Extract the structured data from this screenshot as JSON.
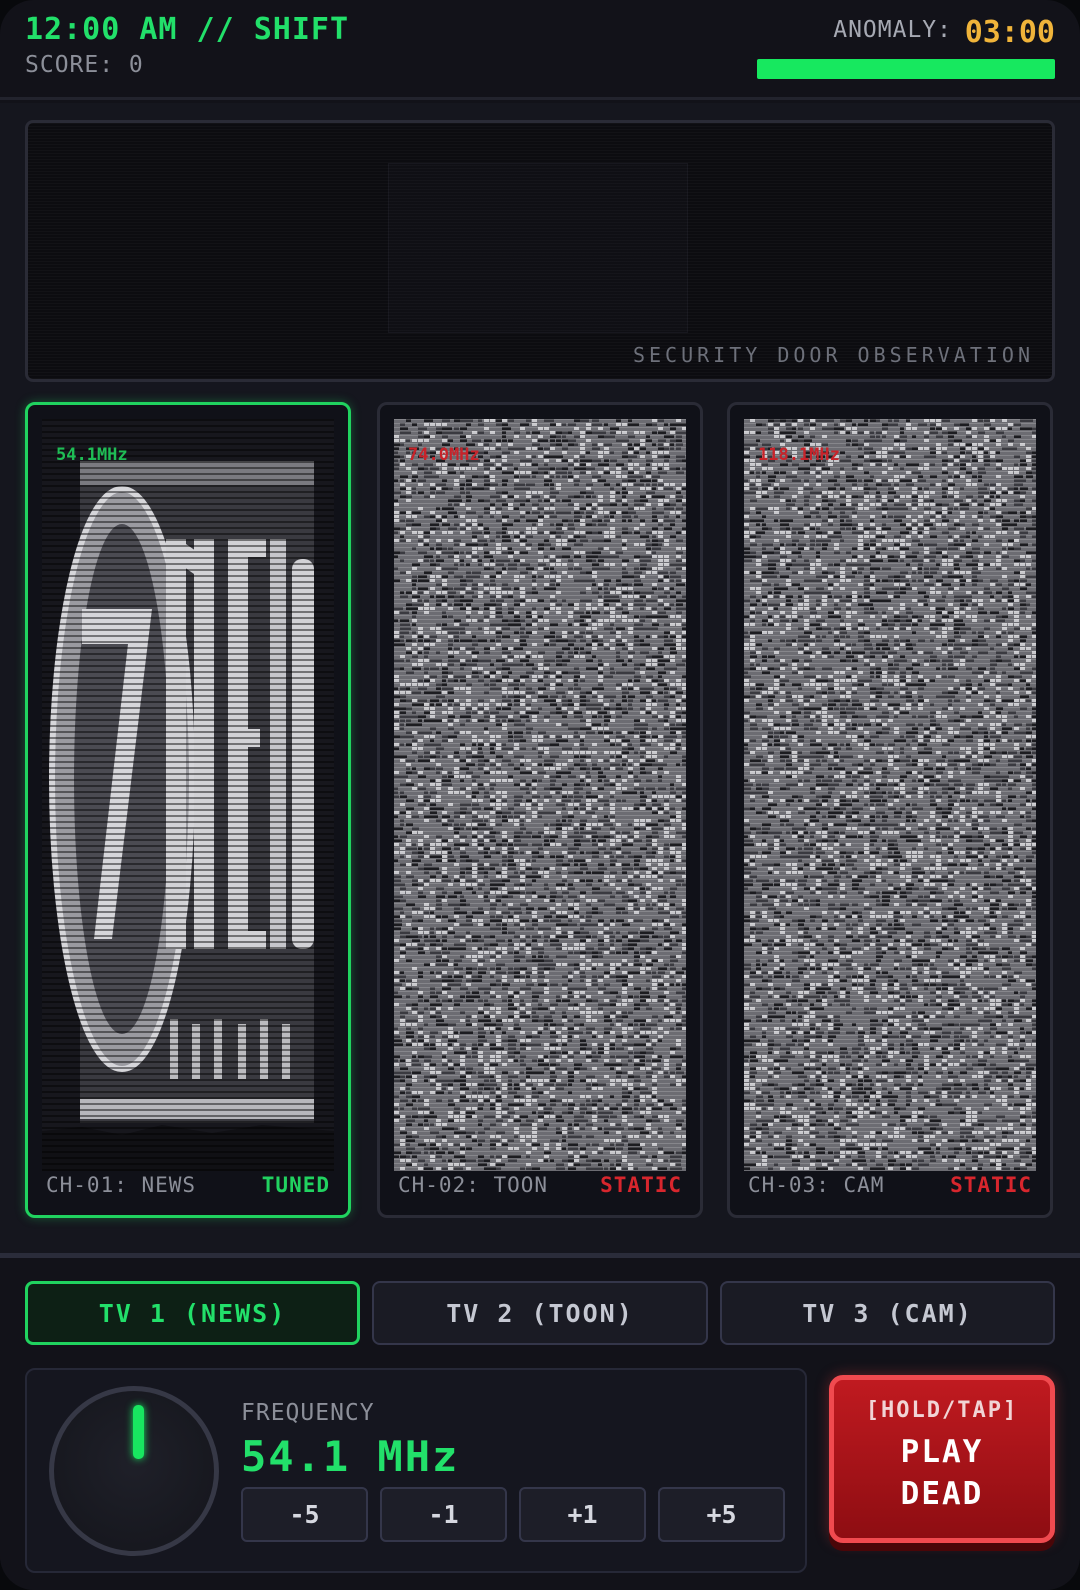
{
  "header": {
    "clock": "12:00 AM // SHIFT",
    "score": "SCORE: 0",
    "anomaly_label": "ANOMALY:",
    "anomaly_time": "03:00",
    "anomaly_fill_fraction": 1.0
  },
  "door_view": {
    "label": "SECURITY DOOR OBSERVATION"
  },
  "tvs": [
    {
      "freq": "54.1MHz",
      "channel": "CH-01: NEWS",
      "state": "TUNED",
      "display": "news-logo"
    },
    {
      "freq": "74.0MHz",
      "channel": "CH-02: TOON",
      "state": "STATIC",
      "display": "static"
    },
    {
      "freq": "118.1MHz",
      "channel": "CH-03: CAM",
      "state": "STATIC",
      "display": "static"
    }
  ],
  "tabs": [
    "TV 1 (NEWS)",
    "TV 2 (TOON)",
    "TV 3 (CAM)"
  ],
  "active_tab": 0,
  "tuner": {
    "title": "FREQUENCY",
    "value": "54.1 MHz",
    "steps": [
      "-5",
      "-1",
      "+1",
      "+5"
    ]
  },
  "play_dead": {
    "hint": "[HOLD/TAP]",
    "line1": "PLAY",
    "line2": "DEAD"
  },
  "colors": {
    "accent_green": "#22e06a",
    "timer_amber": "#f0b43a",
    "static_red": "#d8262d",
    "button_red": "#c01a20"
  }
}
